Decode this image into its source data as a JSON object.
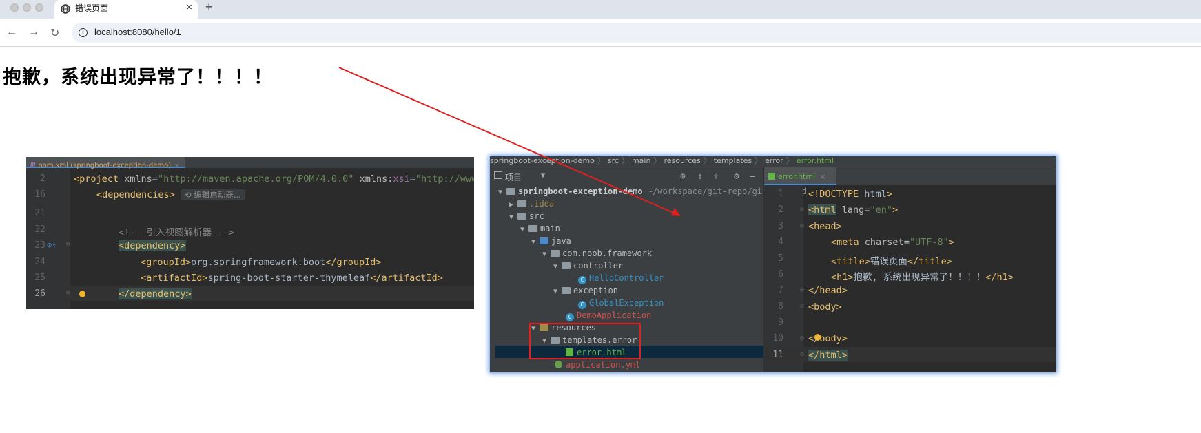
{
  "browser": {
    "tab_title": "错误页面",
    "tab_close": "×",
    "new_tab": "+",
    "back": "←",
    "forward": "→",
    "reload": "↻",
    "url": "localhost:8080/hello/1"
  },
  "page": {
    "heading": "抱歉，系统出现异常了！！！！"
  },
  "left_editor": {
    "tab_icon": "m",
    "tab_label": "pom.xml (springboot-exception-demo)",
    "tab_close": "×",
    "lines": [
      {
        "num": "2",
        "text_pre": "<project xmlns=\"http://maven.apache.org/POM/4.0.0\" xmlns:xsi=\"http://www"
      },
      {
        "num": "16",
        "text": "<dependencies>",
        "inlay": "编辑启动器..."
      },
      {
        "num": "21",
        "text": ""
      },
      {
        "num": "22",
        "text": "<!-- 引入视图解析器 -->"
      },
      {
        "num": "23",
        "text": "<dependency>"
      },
      {
        "num": "24",
        "text": "<groupId>org.springframework.boot</groupId>"
      },
      {
        "num": "25",
        "text": "<artifactId>spring-boot-starter-thymeleaf</artifactId>"
      },
      {
        "num": "26",
        "text": "</dependency>"
      }
    ]
  },
  "right_ide": {
    "breadcrumbs": [
      "springboot-exception-demo",
      "src",
      "main",
      "resources",
      "templates",
      "error",
      "error.html"
    ],
    "project_label": "项目",
    "project_root": "springboot-exception-demo",
    "project_path": "~/workspace/git-repo/github/stud",
    "tree": [
      {
        "label": ".idea"
      },
      {
        "label": "src"
      },
      {
        "label": "main"
      },
      {
        "label": "java"
      },
      {
        "label": "com.noob.framework"
      },
      {
        "label": "controller"
      },
      {
        "label": "HelloController"
      },
      {
        "label": "exception"
      },
      {
        "label": "GlobalException"
      },
      {
        "label": "DemoApplication"
      },
      {
        "label": "resources"
      },
      {
        "label": "templates.error"
      },
      {
        "label": "error.html"
      },
      {
        "label": "application.yml"
      }
    ],
    "editor_tab": "error.html",
    "editor_tab_close": "×",
    "code_lines": [
      {
        "num": "1",
        "text": "<!DOCTYPE html>"
      },
      {
        "num": "2",
        "text": "<html lang=\"en\">"
      },
      {
        "num": "3",
        "text": "<head>"
      },
      {
        "num": "4",
        "text": "<meta charset=\"UTF-8\">"
      },
      {
        "num": "5",
        "text": "<title>错误页面</title>"
      },
      {
        "num": "6",
        "text": "<h1>抱歉, 系统出现异常了！！！！</h1>"
      },
      {
        "num": "7",
        "text": "</head>"
      },
      {
        "num": "8",
        "text": "<body>"
      },
      {
        "num": "9",
        "text": ""
      },
      {
        "num": "10",
        "text": "</body>"
      },
      {
        "num": "11",
        "text": "</html>"
      }
    ]
  },
  "colors": {
    "annotation_red": "#e0201f",
    "ide_bg": "#2b2b2b",
    "tag_yellow": "#e8bf6a",
    "string_green": "#6a8759"
  }
}
